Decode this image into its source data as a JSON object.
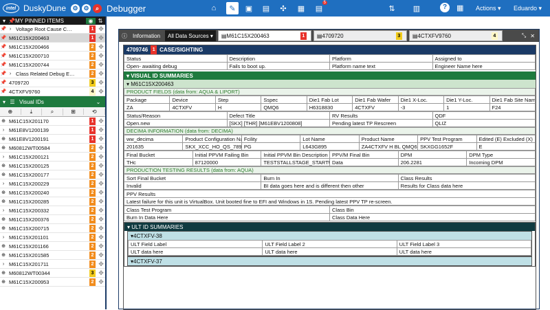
{
  "app": {
    "title": "DuskyDune",
    "subtitle": "Debugger",
    "logo": "intel",
    "nav_badge": "5",
    "actions": "Actions ▾",
    "user": "Eduardo ▾",
    "help": "?"
  },
  "pinned": {
    "title": "MY PINNED ITEMS",
    "items": [
      {
        "label": "Voltage Root Cause C…",
        "badge": "1",
        "level": 1,
        "caret": true
      },
      {
        "label": "M61C15X200463",
        "badge": "1",
        "level": 1,
        "sel": true
      },
      {
        "label": "M61C15X200466",
        "badge": "2",
        "level": 2
      },
      {
        "label": "M61C15X200710",
        "badge": "2",
        "level": 2
      },
      {
        "label": "M61C15X200744",
        "badge": "2",
        "level": 2
      },
      {
        "label": "Class Related Debug E…",
        "badge": "2",
        "level": 2,
        "caret": true
      },
      {
        "label": "4709720",
        "badge": "3",
        "level": 3
      },
      {
        "label": "4CTXFV9760",
        "badge": "4",
        "level": 4
      }
    ]
  },
  "visual": {
    "title": "Visual IDs",
    "items": [
      {
        "label": "M61C15X201170",
        "badge": "1",
        "level": 1
      },
      {
        "label": "M61E8V1200139",
        "badge": "1",
        "level": 1
      },
      {
        "label": "M61E8V1200191",
        "badge": "1",
        "level": 1
      },
      {
        "label": "M60812WT00584",
        "badge": "2",
        "level": 2
      },
      {
        "label": "M61C15X200121",
        "badge": "2",
        "level": 2
      },
      {
        "label": "M61C15X200125",
        "badge": "2",
        "level": 2
      },
      {
        "label": "M61C15X200177",
        "badge": "2",
        "level": 2
      },
      {
        "label": "M61C15X200229",
        "badge": "2",
        "level": 2
      },
      {
        "label": "M61C15X200240",
        "badge": "2",
        "level": 2
      },
      {
        "label": "M61C15X200285",
        "badge": "2",
        "level": 2
      },
      {
        "label": "M61C15X200332",
        "badge": "2",
        "level": 2
      },
      {
        "label": "M61C15X200376",
        "badge": "2",
        "level": 2
      },
      {
        "label": "M61C15X200715",
        "badge": "2",
        "level": 2
      },
      {
        "label": "M61C15X201101",
        "badge": "2",
        "level": 2
      },
      {
        "label": "M61C15X201166",
        "badge": "2",
        "level": 2
      },
      {
        "label": "M61C15X201585",
        "badge": "2",
        "level": 2
      },
      {
        "label": "M61C15X201711",
        "badge": "2",
        "level": 2
      },
      {
        "label": "M60812WT00344",
        "badge": "3",
        "level": 3
      },
      {
        "label": "M61C15X200953",
        "badge": "2",
        "level": 2
      }
    ]
  },
  "tabs": {
    "info": "Information",
    "source": "All Data Sources ▾",
    "docs": [
      {
        "label": "M61C15X200463",
        "badge": "1",
        "level": 1,
        "cur": true
      },
      {
        "label": "4709720",
        "badge": "3",
        "level": 3
      },
      {
        "label": "4CTXFV9760",
        "badge": "4",
        "level": 4
      }
    ]
  },
  "case": {
    "id": "4709746",
    "badge": "1",
    "title": "CASE/SIGHTING",
    "headers": [
      "Status",
      "Description",
      "Platform",
      "Assigned to"
    ],
    "values": [
      "Open- awaiting debug",
      "Fails to boot up.",
      "Platform name text",
      "Engineer Name here"
    ]
  },
  "vid": {
    "title": "VISUAL ID SUMMARIES",
    "unit": "M61C15X200463",
    "product_title": "PRODUCT FIELDS (data from: AQUA & LIPORT)",
    "product_headers": [
      "Package",
      "Device",
      "Step",
      "Sspec",
      "Die1 Fab Lot",
      "Die1 Fab Wafer",
      "Die1 X-Loc.",
      "Die1 Y-Loc.",
      "Die1 Fab Site Name"
    ],
    "product_values": [
      "ZA",
      "4CTXFV",
      "H",
      "QMQ6",
      "H6318830",
      "4CTXFV",
      "-3",
      "1",
      "F24"
    ],
    "status_headers": [
      "Status/Reason",
      "Defect Title",
      "RV Results",
      "QDF"
    ],
    "status_values": [
      "Open.new",
      "[SKX] [THR] [M61EBV1200808]",
      "Pending latest TP Rescreen",
      "QLIZ"
    ],
    "decima_title": "DECIMA INFORMATION (data from: DECIMA)",
    "decima_headers": [
      "ww_decima",
      "Product Configuration Name",
      "Fcility",
      "Lot Name",
      "Product Name",
      "PPV Test Program",
      "Edited (E) Excluded (X)"
    ],
    "decima_values": [
      "201635",
      "SKX_XCC_HO_QS_7899",
      "PG",
      "L643G895",
      "ZA4CTXFV H BL QMQ61",
      "SKXGG1652F",
      "E"
    ],
    "bin_headers": [
      "Final Bucket",
      "Initial PPVM Failing Bin",
      "Initial PPVM Bin Description",
      "PPV/M Final Bin",
      "DPM",
      "DPM Type"
    ],
    "bin_values": [
      "THc",
      "87120000",
      "TESTSTALLSTAGE_STARTUP",
      "Data",
      "206.2281",
      "Incoming DPM"
    ],
    "prod_title": "PRODUCTION TESTING RESULTS (data from: AQUA)",
    "prod_headers": [
      "Sort Final Bucket",
      "Burn In",
      "Class Results"
    ],
    "prod_values": [
      "Invalid",
      "BI data goes here and is different then other",
      "Results for Class data here"
    ],
    "ppv_label": "PPV Results",
    "ppv_text": "Latest failure for this unit is VirtualBox. Unit booted fine to EFI and Windows in 1S. Pending latest PPV TP re-screen.",
    "class_headers": [
      "Class Test Program",
      "Class Bin"
    ],
    "class_values": [
      "Burn In Data Here",
      "Class Data Here"
    ]
  },
  "ult": {
    "title": "ULT ID SUMMARIES",
    "items": [
      {
        "label": "4CTXFV-38",
        "headers": [
          "ULT Field Label",
          "ULT Field Label 2",
          "ULT Field Label 3"
        ],
        "values": [
          "ULT data here",
          "ULT data here",
          "ULT data here"
        ]
      },
      {
        "label": "4CTXFV-37"
      }
    ]
  },
  "colors": {
    "primary": "#1f6fc0",
    "navy": "#1a3a66",
    "green": "#1e7a3e",
    "teal": "#0f3a40",
    "red": "#e8322b",
    "orange": "#f28c1c",
    "yellow": "#f2cc1c"
  }
}
